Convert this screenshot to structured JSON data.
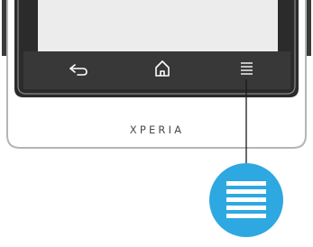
{
  "device": {
    "brand_text": "XPERIA"
  },
  "nav_bar": {
    "buttons": [
      {
        "name": "back",
        "icon": "back-arrow-icon"
      },
      {
        "name": "home",
        "icon": "home-icon"
      },
      {
        "name": "menu",
        "icon": "menu-icon"
      }
    ]
  },
  "callout": {
    "icon": "menu-icon",
    "color": "#2ea8e0"
  },
  "colors": {
    "screen": "#ececec",
    "nav_bar": "#3b3b3b",
    "device_body": "#2a2a2a",
    "bezel": "#555555",
    "callout_accent": "#2ea8e0"
  }
}
